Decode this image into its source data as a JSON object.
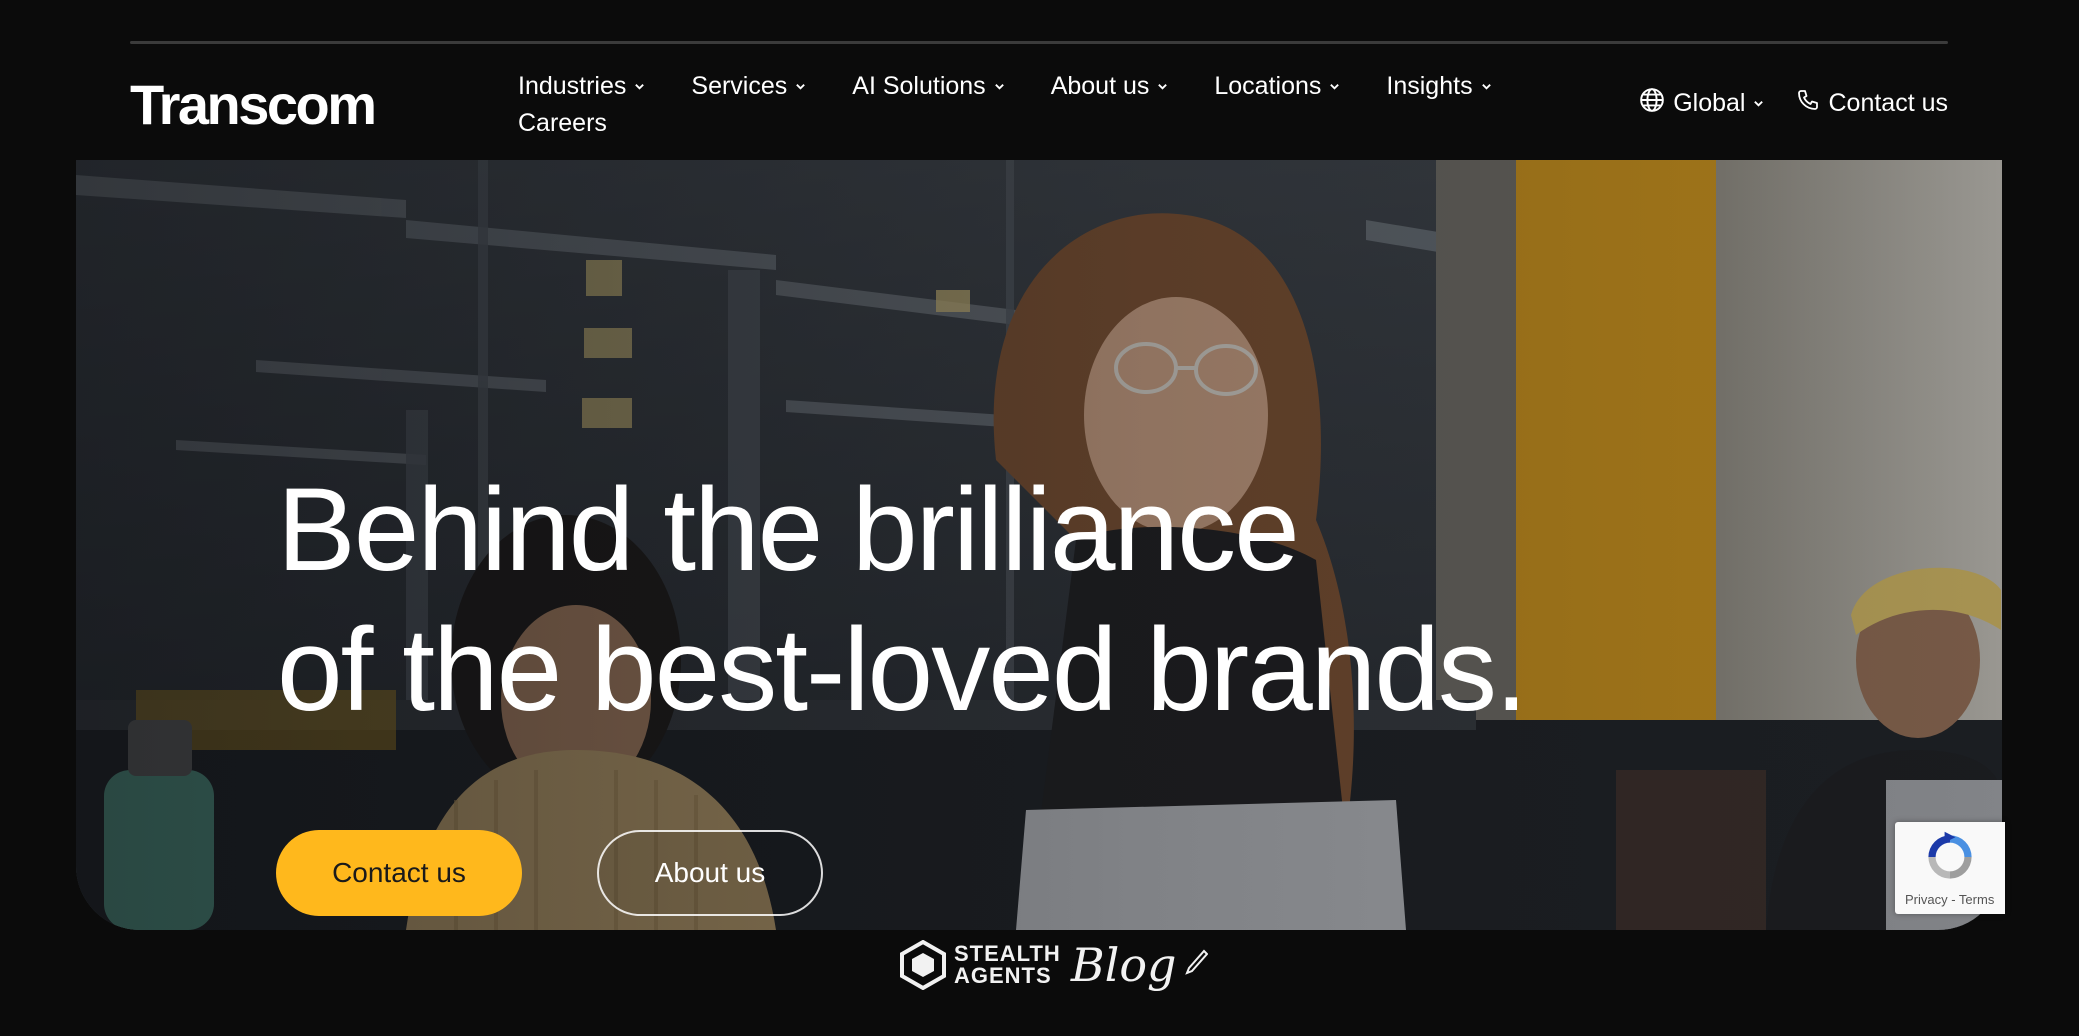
{
  "brand": {
    "logo_text": "Transcom"
  },
  "nav": {
    "items": [
      {
        "label": "Industries",
        "has_dropdown": true
      },
      {
        "label": "Services",
        "has_dropdown": true
      },
      {
        "label": "AI Solutions",
        "has_dropdown": true
      },
      {
        "label": "About us",
        "has_dropdown": true
      },
      {
        "label": "Locations",
        "has_dropdown": true
      },
      {
        "label": "Insights",
        "has_dropdown": true
      },
      {
        "label": "Careers",
        "has_dropdown": false
      }
    ]
  },
  "utility": {
    "region_label": "Global",
    "contact_label": "Contact us"
  },
  "hero": {
    "headline_line1": "Behind the brilliance",
    "headline_line2": "of the best-loved brands.",
    "primary_button": "Contact us",
    "secondary_button": "About us"
  },
  "recaptcha": {
    "links": "Privacy - Terms"
  },
  "watermark": {
    "line1": "STEALTH",
    "line2": "AGENTS",
    "script": "Blog"
  },
  "colors": {
    "accent": "#ffb81c",
    "background": "#0b0b0b",
    "text": "#ffffff"
  }
}
